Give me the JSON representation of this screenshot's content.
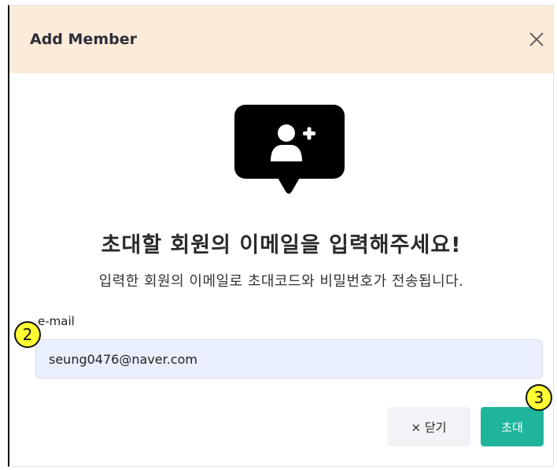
{
  "modal": {
    "title": "Add Member",
    "close_icon": "close-icon",
    "illustration_icon": "user-plus-icon"
  },
  "content": {
    "headline": "초대할 회원의 이메일을 입력해주세요!",
    "subtext": "입력한 회원의 이메일로 초대코드와 비밀번호가 전송됩니다."
  },
  "form": {
    "email_label": "e-mail",
    "email_value": "seung0476@naver.com"
  },
  "buttons": {
    "close_label": "× 닫기",
    "invite_label": "초대"
  },
  "annotations": {
    "marker_2": "2",
    "marker_3": "3"
  },
  "colors": {
    "header_bg": "#fcebd9",
    "input_bg": "#e9efff",
    "invite_button": "#1fb59a",
    "close_button": "#f1f3f6",
    "marker": "#ffff33"
  }
}
